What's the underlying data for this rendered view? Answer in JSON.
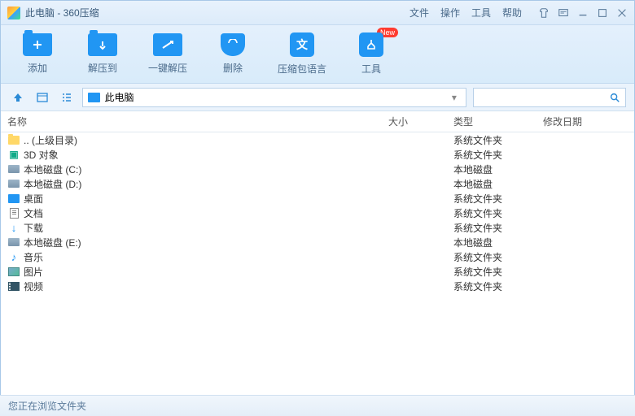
{
  "title": "此电脑 - 360压缩",
  "menu": {
    "file": "文件",
    "operate": "操作",
    "tools": "工具",
    "help": "帮助"
  },
  "toolbar": {
    "add": "添加",
    "extract_to": "解压到",
    "extract_one": "一键解压",
    "delete": "删除",
    "language": "压缩包语言",
    "tools": "工具",
    "new_badge": "New"
  },
  "path": {
    "label": "此电脑"
  },
  "search": {
    "placeholder": ""
  },
  "columns": {
    "name": "名称",
    "size": "大小",
    "type": "类型",
    "date": "修改日期"
  },
  "files": [
    {
      "icon": "folder",
      "name": ".. (上级目录)",
      "type": "系统文件夹"
    },
    {
      "icon": "3d",
      "name": "3D 对象",
      "type": "系统文件夹"
    },
    {
      "icon": "drive",
      "name": "本地磁盘 (C:)",
      "type": "本地磁盘"
    },
    {
      "icon": "drive",
      "name": "本地磁盘 (D:)",
      "type": "本地磁盘"
    },
    {
      "icon": "desktop",
      "name": "桌面",
      "type": "系统文件夹"
    },
    {
      "icon": "doc",
      "name": "文档",
      "type": "系统文件夹"
    },
    {
      "icon": "dl",
      "name": "下载",
      "type": "系统文件夹"
    },
    {
      "icon": "drive",
      "name": "本地磁盘 (E:)",
      "type": "本地磁盘"
    },
    {
      "icon": "music",
      "name": "音乐",
      "type": "系统文件夹"
    },
    {
      "icon": "pic",
      "name": "图片",
      "type": "系统文件夹"
    },
    {
      "icon": "vid",
      "name": "视频",
      "type": "系统文件夹"
    }
  ],
  "status": "您正在浏览文件夹"
}
